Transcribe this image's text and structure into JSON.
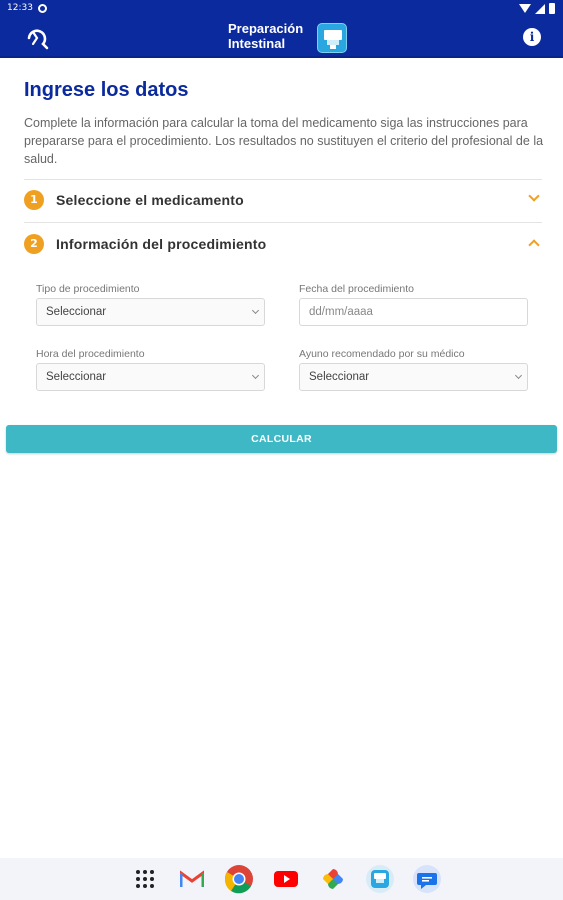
{
  "status_bar": {
    "time": "12:33"
  },
  "app_bar": {
    "title_line1": "Preparación",
    "title_line2": "Intestinal"
  },
  "main": {
    "heading": "Ingrese los datos",
    "intro": "Complete la información para calcular la toma del medicamento siga las instrucciones para prepararse para el procedimiento. Los resultados no sustituyen el criterio del profesional de la salud.",
    "steps": [
      {
        "number": "1",
        "label": "Seleccione el medicamento",
        "expanded": false
      },
      {
        "number": "2",
        "label": "Información del procedimiento",
        "expanded": true
      }
    ],
    "form": {
      "tipo_label": "Tipo de procedimiento",
      "tipo_value": "Seleccionar",
      "fecha_label": "Fecha del procedimiento",
      "fecha_placeholder": "dd/mm/aaaa",
      "hora_label": "Hora del procedimiento",
      "hora_value": "Seleccionar",
      "ayuno_label": "Ayuno recomendado por su médico",
      "ayuno_value": "Seleccionar"
    },
    "calculate_label": "CALCULAR"
  },
  "dock": [
    "apps-grid-icon",
    "gmail-icon",
    "chrome-icon",
    "youtube-icon",
    "photos-icon",
    "preparacion-app-icon",
    "messages-icon"
  ],
  "colors": {
    "primary": "#0b2a9e",
    "accent": "#f0a020",
    "button": "#3db8c4"
  }
}
